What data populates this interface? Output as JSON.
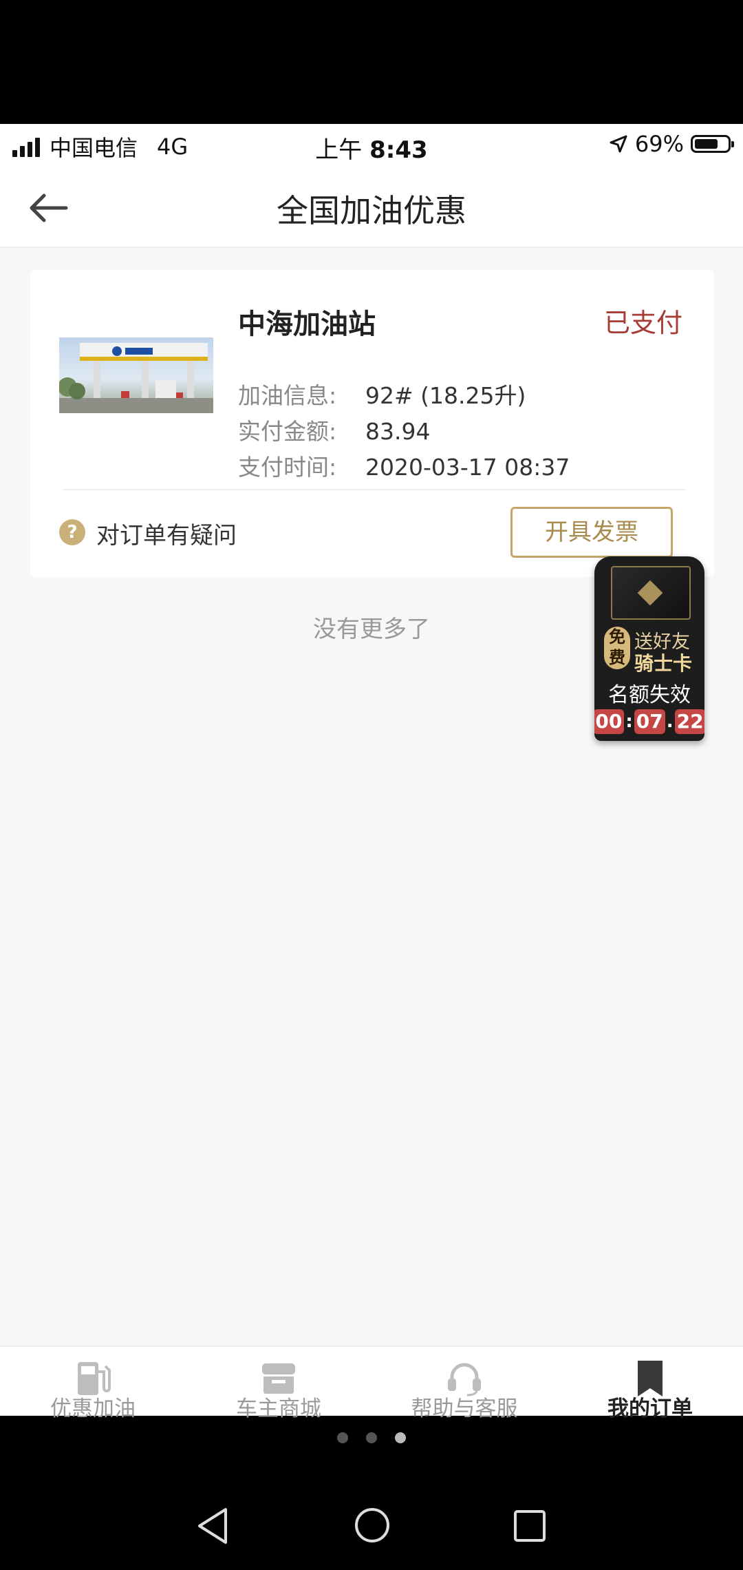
{
  "status_bar": {
    "carrier": "中国电信",
    "network": "4G",
    "time_prefix": "上午",
    "time": "8:43",
    "battery": "69%",
    "battery_level": 0.69
  },
  "header": {
    "title": "全国加油优惠"
  },
  "order": {
    "station_name": "中海加油站",
    "status": "已支付",
    "fuel_label": "加油信息:",
    "fuel_value": "92# (18.25升)",
    "amount_label": "实付金额:",
    "amount_value": "83.94",
    "time_label": "支付时间:",
    "time_value": "2020-03-17 08:37",
    "question_text": "对订单有疑问",
    "invoice_button": "开具发票"
  },
  "list_end_text": "没有更多了",
  "promo": {
    "free_label": "免费",
    "line1": "送好友",
    "line2": "骑士卡",
    "expire_text": "名额失效",
    "countdown": {
      "hours": "00",
      "minutes": "07",
      "seconds": "22"
    }
  },
  "tabbar": {
    "items": [
      {
        "label": "优惠加油",
        "icon": "fuel-pump-icon",
        "active": false
      },
      {
        "label": "车主商城",
        "icon": "store-icon",
        "active": false
      },
      {
        "label": "帮助与客服",
        "icon": "headset-icon",
        "active": false
      },
      {
        "label": "我的订单",
        "icon": "bookmark-icon",
        "active": true
      }
    ]
  },
  "page_indicator": {
    "count": 3,
    "active_index": 1
  },
  "colors": {
    "paid_status": "#a93b36",
    "gold_accent": "#c6a467",
    "background": "#f7f7f7"
  }
}
